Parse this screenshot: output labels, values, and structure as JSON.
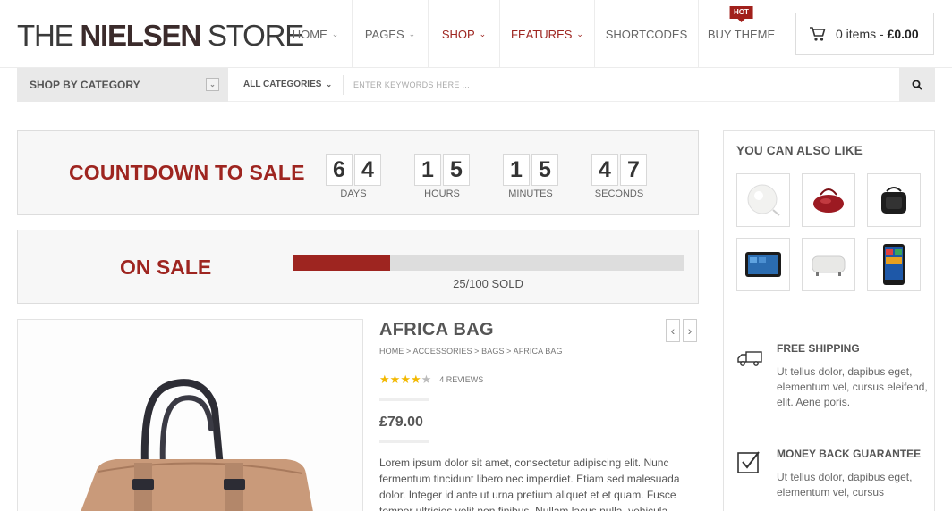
{
  "header": {
    "logo_the": "THE ",
    "logo_nielsen": "NIELSEN",
    "logo_store": " STORE",
    "nav": [
      {
        "label": "HOME",
        "caret": "⌄",
        "accent": false
      },
      {
        "label": "PAGES",
        "caret": "⌄",
        "accent": false
      },
      {
        "label": "SHOP",
        "caret": "⌄",
        "accent": true
      },
      {
        "label": "FEATURES",
        "caret": "⌄",
        "accent": true
      },
      {
        "label": "SHORTCODES",
        "caret": "",
        "accent": false
      },
      {
        "label": "BUY THEME",
        "caret": "",
        "accent": false,
        "badge": "HOT"
      }
    ],
    "cart": {
      "items": "0 items - ",
      "total": "£0.00",
      "icon": "cart-icon"
    }
  },
  "searchbar": {
    "shop_by_category": "SHOP BY CATEGORY",
    "all_categories": "ALL CATEGORIES",
    "placeholder": "ENTER KEYWORDS HERE ...",
    "search_icon": "search-icon"
  },
  "countdown": {
    "title": "COUNTDOWN TO SALE",
    "units": [
      {
        "digits": [
          "6",
          "4"
        ],
        "label": "DAYS"
      },
      {
        "digits": [
          "1",
          "5"
        ],
        "label": "HOURS"
      },
      {
        "digits": [
          "1",
          "5"
        ],
        "label": "MINUTES"
      },
      {
        "digits": [
          "4",
          "7"
        ],
        "label": "SECONDS"
      }
    ]
  },
  "onsale": {
    "title": "ON SALE",
    "sold": 25,
    "total": 100,
    "sold_label": "25/100 SOLD"
  },
  "product": {
    "title": "AFRICA BAG",
    "breadcrumb": "HOME > ACCESSORIES > BAGS > AFRICA BAG",
    "rating": 4,
    "reviews": "4 REVIEWS",
    "price": "£79.00",
    "description": "Lorem ipsum dolor sit amet, consectetur adipiscing elit. Nunc fermentum tincidunt libero nec imperdiet. Etiam sed malesuada dolor. Integer id ante ut urna pretium aliquet et et quam. Fusce tempor ultricies velit non finibus. Nullam lacus nulla, vehicula"
  },
  "sidebar": {
    "title": "YOU CAN ALSO LIKE",
    "thumbnails": [
      "lamp",
      "red-handbag",
      "camera-bag",
      "tablet",
      "ottoman",
      "smartphone"
    ],
    "features": [
      {
        "icon": "truck-icon",
        "title": "FREE SHIPPING",
        "text": "Ut tellus dolor, dapibus eget, elementum vel, cursus eleifend, elit. Aene poris."
      },
      {
        "icon": "checkbox-icon",
        "title": "MONEY BACK GUARANTEE",
        "text": "Ut tellus dolor, dapibus eget, elementum vel, cursus"
      }
    ]
  },
  "colors": {
    "accent": "#9e2520",
    "star": "#f2b800"
  }
}
